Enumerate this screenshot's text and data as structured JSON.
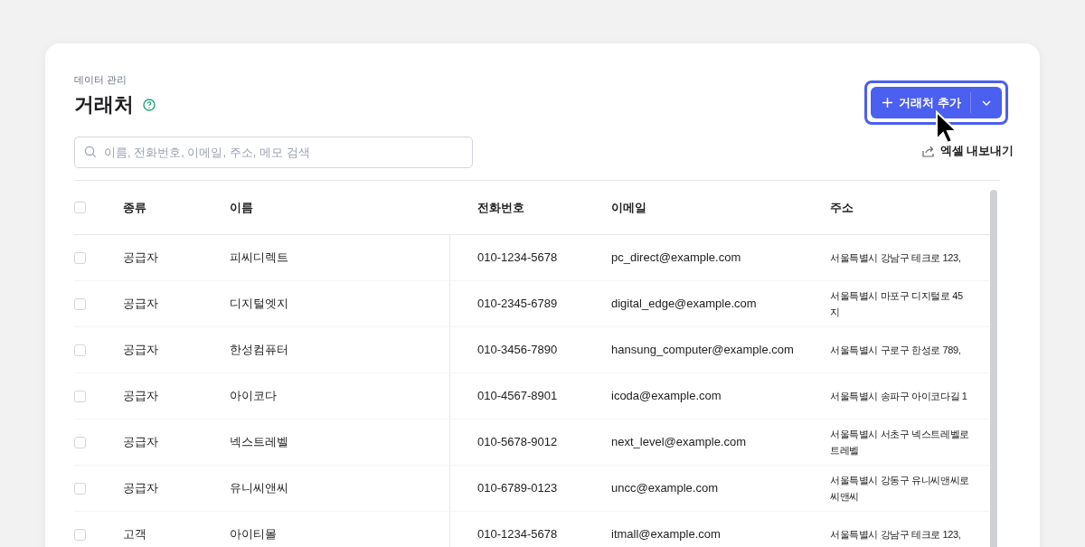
{
  "breadcrumb": "데이터 관리",
  "title": "거래처",
  "search": {
    "placeholder": "이름, 전화번호, 이메일, 주소, 메모 검색"
  },
  "add_button": {
    "label": "거래처 추가",
    "focused": true
  },
  "export_link": "엑셀 내보내기",
  "table": {
    "columns": [
      "종류",
      "이름",
      "전화번호",
      "이메일",
      "주소"
    ],
    "header_checked": false,
    "rows": [
      {
        "checked": false,
        "type": "공급자",
        "name": "피씨디렉트",
        "phone": "010-1234-5678",
        "email": "pc_direct@example.com",
        "address": [
          "서울특별시 강남구 테크로 123,"
        ]
      },
      {
        "checked": false,
        "type": "공급자",
        "name": "디지털엣지",
        "phone": "010-2345-6789",
        "email": "digital_edge@example.com",
        "address": [
          "서울특별시 마포구 디지털로 45",
          "지"
        ]
      },
      {
        "checked": false,
        "type": "공급자",
        "name": "한성컴퓨터",
        "phone": "010-3456-7890",
        "email": "hansung_computer@example.com",
        "address": [
          "서울특별시 구로구 한성로 789,"
        ]
      },
      {
        "checked": false,
        "type": "공급자",
        "name": "아이코다",
        "phone": "010-4567-8901",
        "email": "icoda@example.com",
        "address": [
          "서울특별시 송파구 아이코다길 1"
        ]
      },
      {
        "checked": false,
        "type": "공급자",
        "name": "넥스트레벨",
        "phone": "010-5678-9012",
        "email": "next_level@example.com",
        "address": [
          "서울특별시 서초구 넥스트레벨로",
          "트레벨"
        ]
      },
      {
        "checked": false,
        "type": "공급자",
        "name": "유니씨앤씨",
        "phone": "010-6789-0123",
        "email": "uncc@example.com",
        "address": [
          "서울특별시 강동구 유니씨앤씨로",
          "씨앤씨"
        ]
      },
      {
        "checked": false,
        "type": "고객",
        "name": "아이티몰",
        "phone": "010-1234-5678",
        "email": "itmall@example.com",
        "address": [
          "서울특별시 강남구 테크로 123,"
        ]
      }
    ]
  }
}
